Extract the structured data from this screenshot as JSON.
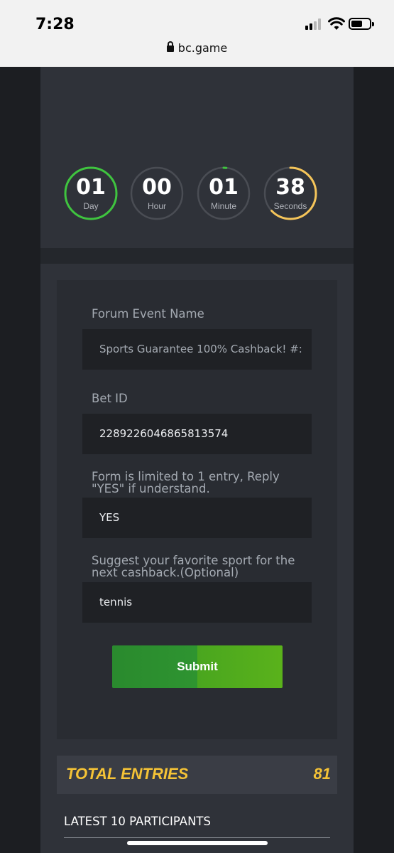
{
  "status_bar": {
    "time": "7:28",
    "url": "bc.game",
    "icons": [
      "signal-icon",
      "wifi-icon",
      "battery-icon",
      "lock-icon"
    ]
  },
  "countdown": {
    "day": {
      "value": "01",
      "label": "Day",
      "color": "#3fc43f",
      "progress": 1.0
    },
    "hour": {
      "value": "00",
      "label": "Hour",
      "color": "#4a4d54",
      "progress": 0.0
    },
    "minute": {
      "value": "01",
      "label": "Minute",
      "color": "#3fc43f",
      "progress": 0.017
    },
    "seconds": {
      "value": "38",
      "label": "Seconds",
      "color": "#f5c55a",
      "progress": 0.63
    }
  },
  "form": {
    "event_name_label": "Forum Event Name",
    "event_name_placeholder": "Sports Guarantee 100% Cashback! #:",
    "bet_id_label": "Bet ID",
    "bet_id_value": "2289226046865813574",
    "entry_limit_label_line1": "Form is limited to 1 entry, Reply",
    "entry_limit_label_line2": "\"YES\" if understand.",
    "entry_limit_value": "YES",
    "suggest_label_line1": "Suggest your favorite sport for the",
    "suggest_label_line2": "next cashback.(Optional)",
    "suggest_value": "tennis",
    "submit_label": "Submit"
  },
  "entries": {
    "title": "TOTAL ENTRIES",
    "count": "81",
    "latest_title": "LATEST 10 PARTICIPANTS"
  },
  "colors": {
    "accent_yellow": "#f5c336",
    "submit_green": "#2e9430",
    "panel": "#2f3239"
  }
}
